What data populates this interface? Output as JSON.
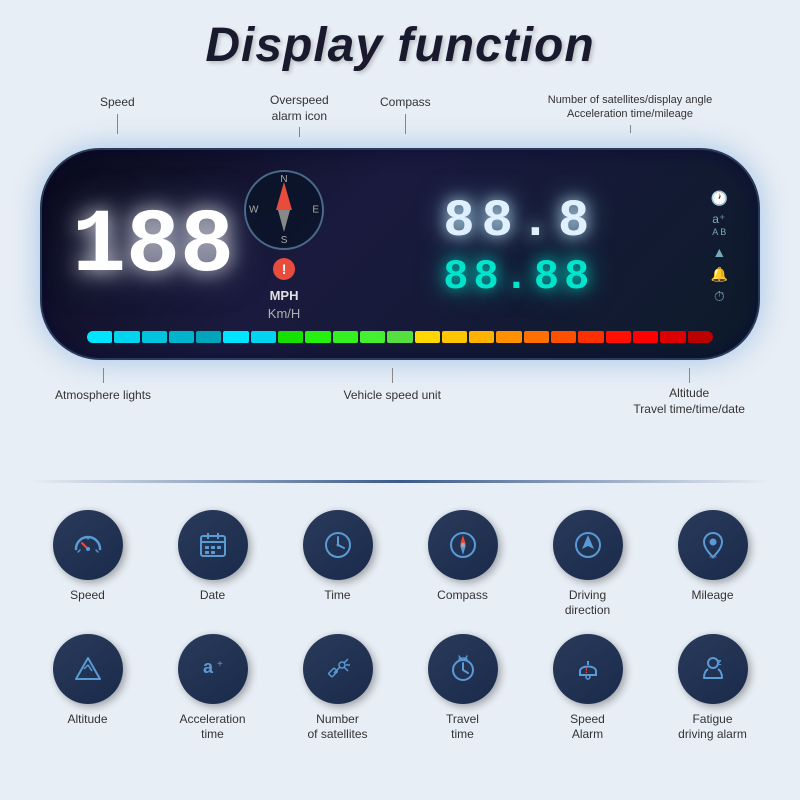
{
  "header": {
    "title": "Display function"
  },
  "labels": {
    "speed": "Speed",
    "overspeed": "Overspeed\nalarm icon",
    "compass": "Compass",
    "right_top": "Number of satellites/display angle\nAcceleration time/mileage",
    "atmosphere": "Atmosphere lights",
    "vehicle_speed": "Vehicle speed unit",
    "altitude": "Altitude\nTravel time/time/date"
  },
  "hud": {
    "speed_digits": "188",
    "mph": "MPH",
    "kmh": "Km/H",
    "top_digits": "888",
    "bottom_digits": "8888"
  },
  "color_bar": {
    "colors": [
      "#00e5ff",
      "#00d4ee",
      "#00c4dd",
      "#00b4cc",
      "#00a4bb",
      "#00e5ff",
      "#00d4ee",
      "#00c4dd",
      "#15e000",
      "#25f010",
      "#35f020",
      "#45f030",
      "#50e040",
      "#60c050",
      "#70a060",
      "#ffd700",
      "#ffc500",
      "#ffb300",
      "#ff9100",
      "#ff7000",
      "#ff5000",
      "#ff3000",
      "#ff1000",
      "#ff0000",
      "#cc0000"
    ]
  },
  "features": [
    {
      "id": "speed",
      "label": "Speed",
      "icon": "speedometer"
    },
    {
      "id": "date",
      "label": "Date",
      "icon": "calendar"
    },
    {
      "id": "time",
      "label": "Time",
      "icon": "clock"
    },
    {
      "id": "compass",
      "label": "Compass",
      "icon": "compass"
    },
    {
      "id": "driving-direction",
      "label": "Driving\ndirection",
      "icon": "navigation"
    },
    {
      "id": "mileage",
      "label": "Mileage",
      "icon": "location-pin"
    },
    {
      "id": "altitude",
      "label": "Altitude",
      "icon": "mountain"
    },
    {
      "id": "acceleration",
      "label": "Acceleration\ntime",
      "icon": "acceleration"
    },
    {
      "id": "satellites",
      "label": "Number\nof satellites",
      "icon": "satellite"
    },
    {
      "id": "travel",
      "label": "Travel\ntime",
      "icon": "travel-clock"
    },
    {
      "id": "speed-alarm",
      "label": "Speed\nAlarm",
      "icon": "alarm"
    },
    {
      "id": "fatigue",
      "label": "Fatigue\ndriving alarm",
      "icon": "fatigue"
    }
  ]
}
